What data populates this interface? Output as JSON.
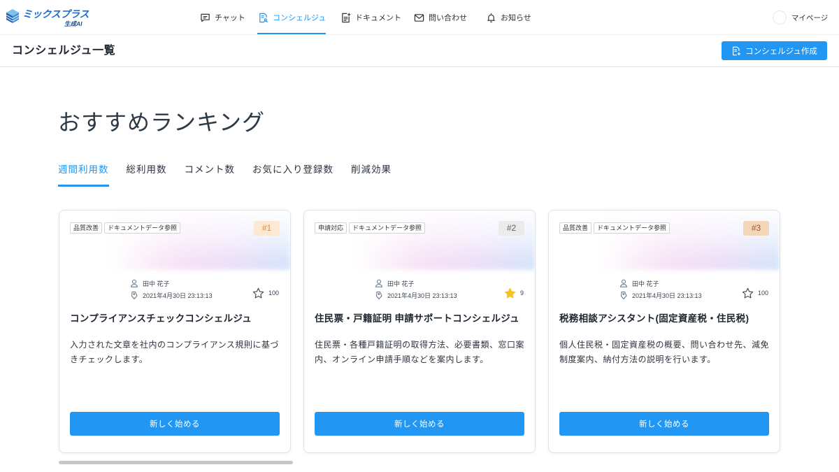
{
  "header": {
    "logo": {
      "name": "ミックスプラス",
      "sub": "生成AI",
      "icon": "cube-logo-icon"
    },
    "nav": [
      {
        "label": "チャット",
        "icon": "chat-icon",
        "active": false
      },
      {
        "label": "コンシェルジュ",
        "icon": "concierge-icon",
        "active": true
      },
      {
        "label": "ドキュメント",
        "icon": "document-icon",
        "active": false
      },
      {
        "label": "問い合わせ",
        "icon": "mail-icon",
        "active": false
      },
      {
        "label": "お知らせ",
        "icon": "bell-icon",
        "active": false
      }
    ],
    "mypage": {
      "label": "マイページ"
    }
  },
  "subheader": {
    "title": "コンシェルジュ一覧",
    "create_button": {
      "label": "コンシェルジュ作成",
      "icon": "add-document-icon"
    }
  },
  "ranking": {
    "heading": "おすすめランキング",
    "tabs": [
      {
        "label": "週間利用数",
        "active": true
      },
      {
        "label": "総利用数",
        "active": false
      },
      {
        "label": "コメント数",
        "active": false
      },
      {
        "label": "お気に入り登録数",
        "active": false
      },
      {
        "label": "削減効果",
        "active": false
      }
    ]
  },
  "cards": [
    {
      "rank": "#1",
      "rank_colors": {
        "bg": "#fde9d2",
        "fg": "#e5883a"
      },
      "tags": [
        "品質改善",
        "ドキュメントデータ参照"
      ],
      "author": "田中 花子",
      "datetime": "2021年4月30日 23:13:13",
      "favorite_count": "100",
      "favorited": false,
      "title": "コンプライアンスチェックコンシェルジュ",
      "description": "入力された文章を社内のコンプライアンス規則に基づきチェックします。",
      "start_button": "新しく始める"
    },
    {
      "rank": "#2",
      "rank_colors": {
        "bg": "#ebebeb",
        "fg": "#5a5f66"
      },
      "tags": [
        "申請対応",
        "ドキュメントデータ参照"
      ],
      "author": "田中 花子",
      "datetime": "2021年4月30日 23:13:13",
      "favorite_count": "9",
      "favorited": true,
      "title": "住民票・戸籍証明 申請サポートコンシェルジュ",
      "description": "住民票・各種戸籍証明の取得方法、必要書類、窓口案内、オンライン申請手順などを案内します。",
      "start_button": "新しく始める"
    },
    {
      "rank": "#3",
      "rank_colors": {
        "bg": "#f3d5b8",
        "fg": "#9a5a2c"
      },
      "tags": [
        "品質改善",
        "ドキュメントデータ参照"
      ],
      "author": "田中 花子",
      "datetime": "2021年4月30日 23:13:13",
      "favorite_count": "100",
      "favorited": false,
      "title": "税務相談アシスタント(固定資産税・住民税)",
      "description": "個人住民税・固定資産税の概要、問い合わせ先、減免制度案内、納付方法の説明を行います。",
      "start_button": "新しく始める"
    }
  ],
  "colors": {
    "accent": "#2196f3",
    "star_filled": "#f7c21b",
    "star_outline": "#3b4756"
  }
}
